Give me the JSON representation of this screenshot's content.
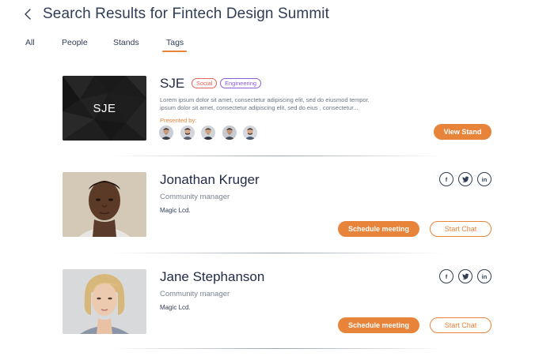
{
  "header": {
    "title": "Search Results for Fintech Design Summit",
    "back_icon": "chevron-left-icon"
  },
  "tabs": [
    {
      "label": "All",
      "active": false
    },
    {
      "label": "People",
      "active": false
    },
    {
      "label": "Stands",
      "active": false
    },
    {
      "label": "Tags",
      "active": true
    }
  ],
  "accent_color": "#e8833a",
  "stand": {
    "name": "SJE",
    "image_text": "SJE",
    "tags": [
      {
        "label": "Social",
        "color": "#e0625a"
      },
      {
        "label": "Engineering",
        "color": "#8a5cd6"
      }
    ],
    "description_line1": "Lorem ipsum dolor sit amet, consectetur adipiscing elit, sed do eiusmod tempor.",
    "description_line2": "ipsum dolor sit amet, consectetur adipiscing elit, sed do eius , consectetur...",
    "presented_label": "Presented by:",
    "presenters_count": 5,
    "button_label": "View Stand"
  },
  "people": [
    {
      "name": "Jonathan Kruger",
      "role": "Community manager",
      "company": "Magic Lcd.",
      "socials": [
        "f",
        "t",
        "in"
      ],
      "primary_button": "Schedule meeting",
      "secondary_button": "Start Chat"
    },
    {
      "name": "Jane Stephanson",
      "role": "Community manager",
      "company": "Magic Lcd.",
      "socials": [
        "f",
        "t",
        "in"
      ],
      "primary_button": "Schedule meeting",
      "secondary_button": "Start Chat"
    }
  ]
}
